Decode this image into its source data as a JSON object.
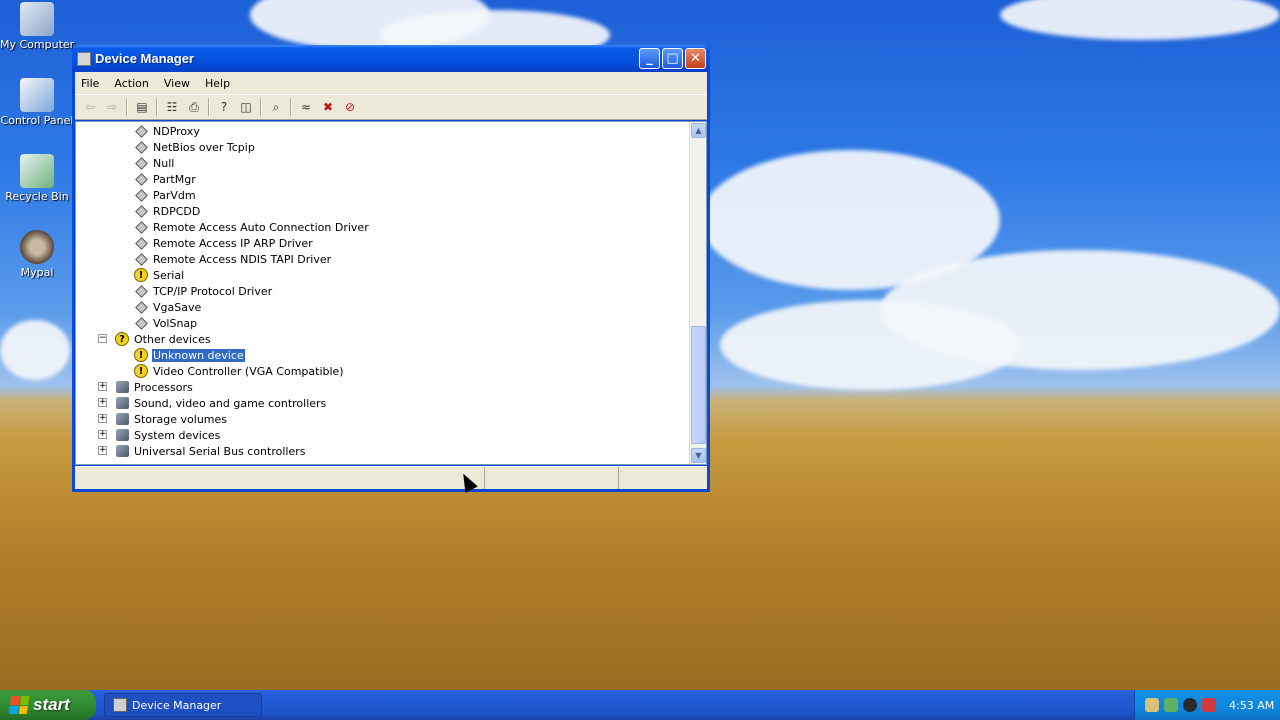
{
  "desktop": {
    "icons": [
      {
        "label": "My Computer"
      },
      {
        "label": "Control Panel"
      },
      {
        "label": "Recycle Bin"
      },
      {
        "label": "Mypal"
      }
    ]
  },
  "window": {
    "title": "Device Manager",
    "menu": [
      "File",
      "Action",
      "View",
      "Help"
    ],
    "tree": {
      "items": [
        {
          "label": "NDProxy",
          "icon": "driver-icon"
        },
        {
          "label": "NetBios over Tcpip",
          "icon": "driver-icon"
        },
        {
          "label": "Null",
          "icon": "driver-icon"
        },
        {
          "label": "PartMgr",
          "icon": "driver-icon"
        },
        {
          "label": "ParVdm",
          "icon": "driver-icon"
        },
        {
          "label": "RDPCDD",
          "icon": "driver-icon"
        },
        {
          "label": "Remote Access Auto Connection Driver",
          "icon": "driver-icon"
        },
        {
          "label": "Remote Access IP ARP Driver",
          "icon": "driver-icon"
        },
        {
          "label": "Remote Access NDIS TAPI Driver",
          "icon": "driver-icon"
        },
        {
          "label": "Serial",
          "icon": "warning-icon"
        },
        {
          "label": "TCP/IP Protocol Driver",
          "icon": "driver-icon"
        },
        {
          "label": "VgaSave",
          "icon": "driver-icon"
        },
        {
          "label": "VolSnap",
          "icon": "driver-icon"
        },
        {
          "label": "Other devices",
          "icon": "question-icon",
          "expander": "−"
        },
        {
          "label": "Unknown device",
          "icon": "warning-icon",
          "selected": true
        },
        {
          "label": "Video Controller (VGA Compatible)",
          "icon": "warning-icon"
        },
        {
          "label": "Processors",
          "icon": "processor-icon",
          "expander": "+"
        },
        {
          "label": "Sound, video and game controllers",
          "icon": "sound-icon",
          "expander": "+"
        },
        {
          "label": "Storage volumes",
          "icon": "storage-icon",
          "expander": "+"
        },
        {
          "label": "System devices",
          "icon": "system-icon",
          "expander": "+"
        },
        {
          "label": "Universal Serial Bus controllers",
          "icon": "usb-icon",
          "expander": "+"
        }
      ]
    }
  },
  "taskbar": {
    "start_label": "start",
    "task_label": "Device Manager",
    "clock": "4:53 AM"
  },
  "colors": {
    "selection": "#316ac5",
    "titlebar": "#0451e0",
    "taskbar": "#245edb",
    "start": "#3c9a3c"
  }
}
